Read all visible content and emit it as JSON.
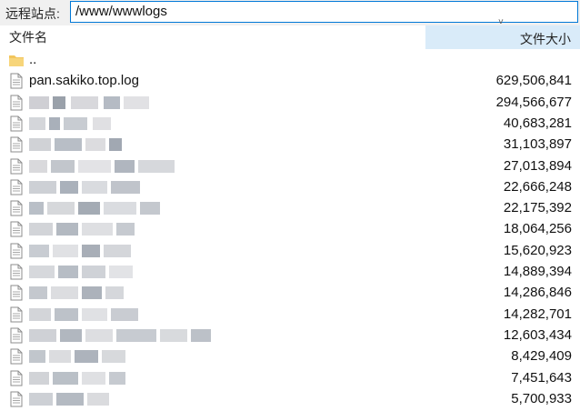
{
  "address": {
    "label": "远程站点:",
    "path": "/www/wwwlogs"
  },
  "header": {
    "name_col": "文件名",
    "size_col": "文件大小",
    "sort_indicator": "˅"
  },
  "rows": [
    {
      "name": "..",
      "size": "",
      "icon": "folder-icon",
      "blurred": false
    },
    {
      "name": "pan.sakiko.top.log",
      "size": "629,506,841",
      "icon": "file-icon",
      "blurred": false
    },
    {
      "name": "",
      "size": "294,566,677",
      "icon": "file-icon",
      "blurred": true
    },
    {
      "name": "",
      "size": "40,683,281",
      "icon": "file-icon",
      "blurred": true
    },
    {
      "name": "",
      "size": "31,103,897",
      "icon": "file-icon",
      "blurred": true
    },
    {
      "name": "",
      "size": "27,013,894",
      "icon": "file-icon",
      "blurred": true
    },
    {
      "name": "",
      "size": "22,666,248",
      "icon": "file-icon",
      "blurred": true
    },
    {
      "name": "",
      "size": "22,175,392",
      "icon": "file-icon",
      "blurred": true
    },
    {
      "name": "",
      "size": "18,064,256",
      "icon": "file-icon",
      "blurred": true
    },
    {
      "name": "",
      "size": "15,620,923",
      "icon": "file-icon",
      "blurred": true
    },
    {
      "name": "",
      "size": "14,889,394",
      "icon": "file-icon",
      "blurred": true
    },
    {
      "name": "",
      "size": "14,286,846",
      "icon": "file-icon",
      "blurred": true
    },
    {
      "name": "",
      "size": "14,282,701",
      "icon": "file-icon",
      "blurred": true
    },
    {
      "name": "",
      "size": "12,603,434",
      "icon": "file-icon",
      "blurred": true
    },
    {
      "name": "",
      "size": "8,429,409",
      "icon": "file-icon",
      "blurred": true
    },
    {
      "name": "",
      "size": "7,451,643",
      "icon": "file-icon",
      "blurred": true
    },
    {
      "name": "",
      "size": "5,700,933",
      "icon": "file-icon",
      "blurred": true
    }
  ],
  "colors": {
    "selected_header": "#d9ebf9",
    "address_border": "#0078d7",
    "folder": "#f2c55c"
  }
}
